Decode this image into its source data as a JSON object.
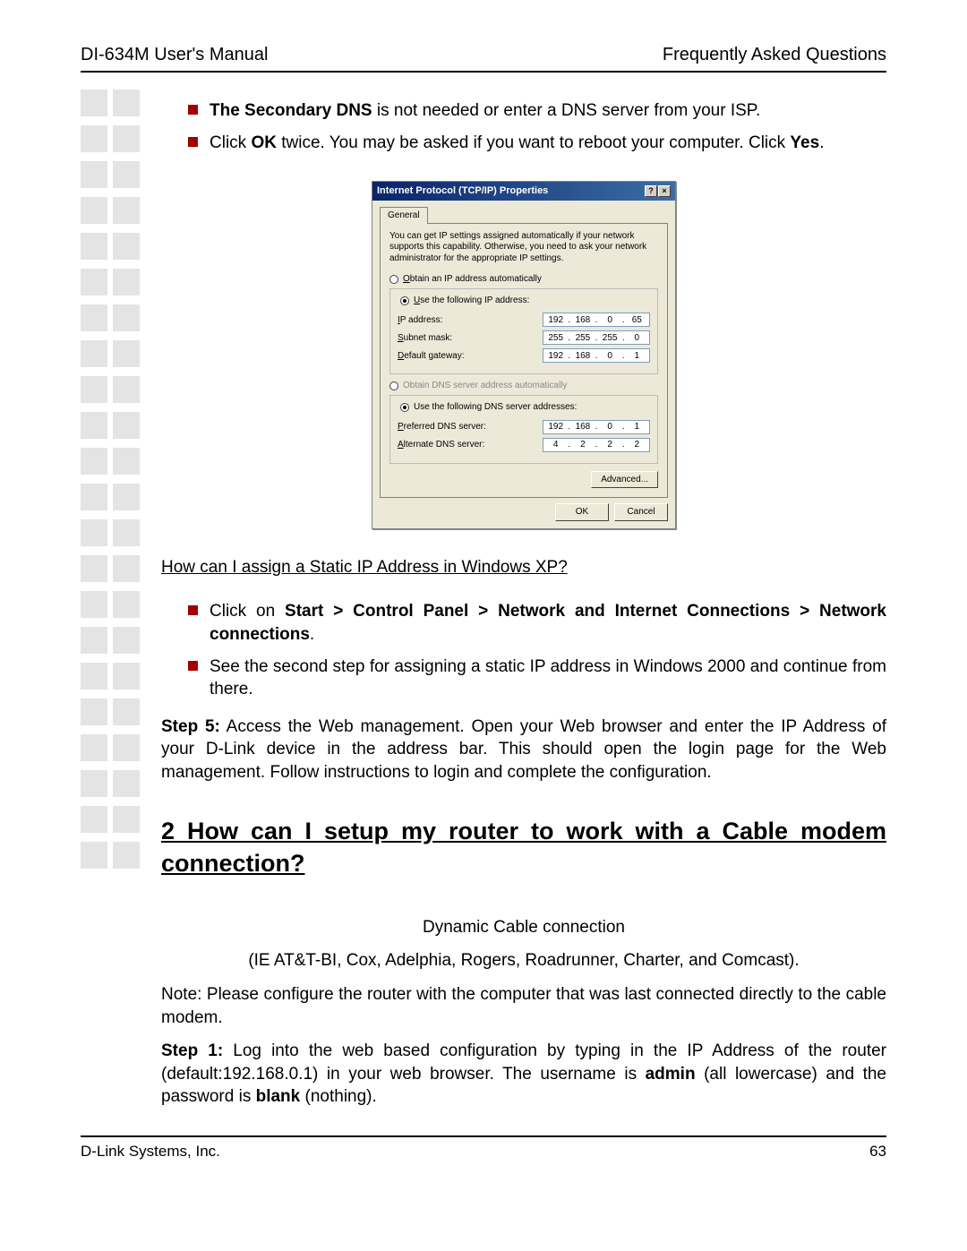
{
  "header": {
    "left": "DI-634M User's Manual",
    "right": "Frequently Asked Questions"
  },
  "side_squares_rows": 22,
  "bullets_top": [
    {
      "html_parts": [
        "<b>The Secondary DNS</b> is not needed or enter a DNS server from your ISP."
      ]
    },
    {
      "html_parts": [
        "Click <b>OK</b> twice. You may be asked if you want to reboot your computer. Click <b>Yes</b>."
      ]
    }
  ],
  "dialog": {
    "title": "Internet Protocol (TCP/IP) Properties",
    "help_btn": "?",
    "close_btn": "×",
    "tab": "General",
    "intro": "You can get IP settings assigned automatically if your network supports this capability. Otherwise, you need to ask your network administrator for the appropriate IP settings.",
    "radio_obtain_ip": "Obtain an IP address automatically",
    "radio_use_ip": "Use the following IP address:",
    "labels": {
      "ip": "IP address:",
      "subnet": "Subnet mask:",
      "gateway": "Default gateway:"
    },
    "ip": [
      "192",
      "168",
      "0",
      "65"
    ],
    "subnet": [
      "255",
      "255",
      "255",
      "0"
    ],
    "gateway": [
      "192",
      "168",
      "0",
      "1"
    ],
    "radio_obtain_dns": "Obtain DNS server address automatically",
    "radio_use_dns": "Use the following DNS server addresses:",
    "labels_dns": {
      "preferred": "Preferred DNS server:",
      "alternate": "Alternate DNS server:"
    },
    "dns1": [
      "192",
      "168",
      "0",
      "1"
    ],
    "dns2": [
      "4",
      "2",
      "2",
      "2"
    ],
    "btn_advanced": "Advanced...",
    "btn_ok": "OK",
    "btn_cancel": "Cancel"
  },
  "heading_xp": "How can I assign a Static IP Address in Windows XP?",
  "bullets_xp": [
    {
      "html_parts": [
        "Click on <b>Start &gt; Control Panel &gt; Network and Internet Connections &gt; Network connections</b>."
      ]
    },
    {
      "html_parts": [
        "See the second step for assigning a static IP address in Windows 2000 and continue from there."
      ]
    }
  ],
  "step5": "<b>Step 5:</b> Access the Web management. Open your Web browser and enter the IP Address of your D-Link device in the address bar. This should open the login page for the Web management. Follow instructions to login and complete the configuration.",
  "section2_heading": "2 How can I setup my router to work with a Cable modem connection?",
  "dyn_title": "Dynamic Cable connection",
  "dyn_sub": "(IE AT&T-BI, Cox, Adelphia, Rogers, Roadrunner, Charter, and Comcast).",
  "note": "Note: Please configure the router with the computer that was last connected directly to the cable modem.",
  "step1": "<b>Step 1:</b> Log into the web based configuration by typing in the IP Address of the router (default:192.168.0.1) in your web browser. The username is <b>admin</b> (all lowercase) and the password is <b>blank</b> (nothing).",
  "footer": {
    "left": "D-Link Systems, Inc.",
    "right": "63"
  }
}
